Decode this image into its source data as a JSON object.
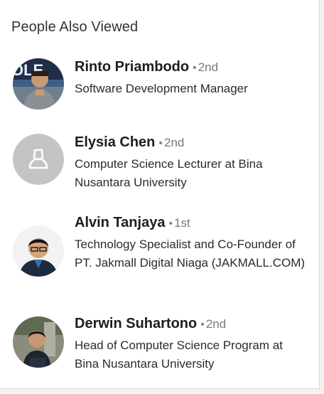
{
  "section": {
    "title": "People Also Viewed"
  },
  "people": [
    {
      "name": "Rinto Priambodo",
      "degree": "2nd",
      "headline": "Software Development Manager"
    },
    {
      "name": "Elysia Chen",
      "degree": "2nd",
      "headline": "Computer Science Lecturer at Bina Nusantara University"
    },
    {
      "name": "Alvin Tanjaya",
      "degree": "1st",
      "headline": "Technology Specialist and Co-Founder of PT. Jakmall Digital Niaga (JAKMALL.COM)"
    },
    {
      "name": "Derwin Suhartono",
      "degree": "2nd",
      "headline": "Head of Computer Science Program at Bina Nusantara University"
    }
  ],
  "icons": {
    "default_avatar": "person-silhouette-icon"
  },
  "colors": {
    "background": "#ffffff",
    "page_background": "#f3f3f3",
    "name_text": "#1d1d1d",
    "degree_text": "#7a7a7a",
    "placeholder_avatar": "#c4c4c4"
  }
}
